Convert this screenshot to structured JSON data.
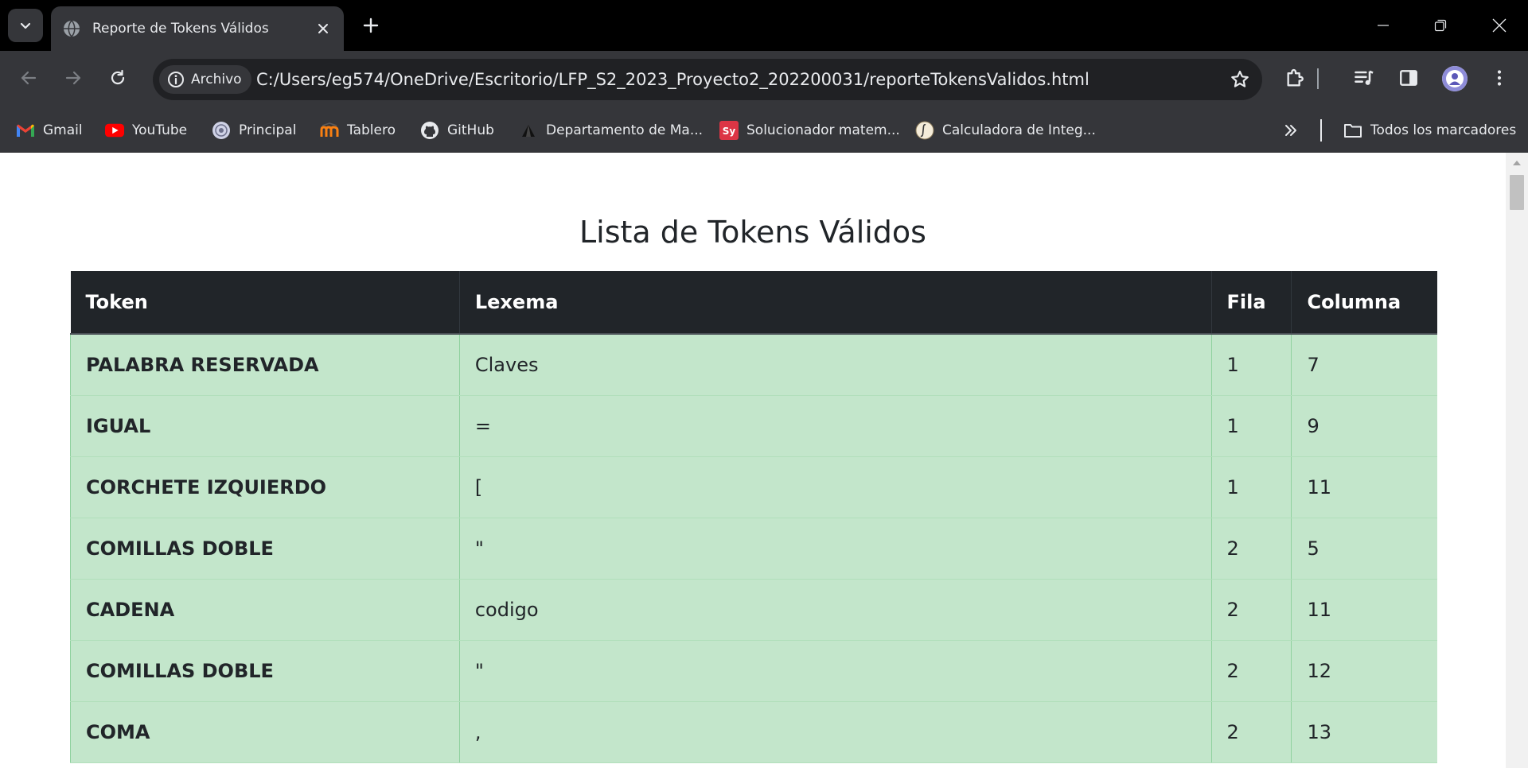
{
  "tab": {
    "title": "Reporte de Tokens Válidos"
  },
  "address_bar": {
    "site_chip": "Archivo",
    "url": "C:/Users/eg574/OneDrive/Escritorio/LFP_S2_2023_Proyecto2_202200031/reporteTokensValidos.html"
  },
  "bookmarks": {
    "items": [
      {
        "label": "Gmail",
        "icon": "gmail-icon"
      },
      {
        "label": "YouTube",
        "icon": "youtube-icon"
      },
      {
        "label": "Principal",
        "icon": "principal-icon"
      },
      {
        "label": "Tablero",
        "icon": "moodle-icon"
      },
      {
        "label": "GitHub",
        "icon": "github-icon"
      },
      {
        "label": "Departamento de Ma...",
        "icon": "triangle-icon"
      },
      {
        "label": "Solucionador matem...",
        "icon": "symbolab-icon"
      },
      {
        "label": "Calculadora de Integ...",
        "icon": "integral-icon"
      }
    ],
    "all_bookmarks": "Todos los marcadores"
  },
  "page": {
    "title": "Lista de Tokens Válidos",
    "table": {
      "headers": [
        "Token",
        "Lexema",
        "Fila",
        "Columna"
      ],
      "rows": [
        [
          "PALABRA RESERVADA",
          "Claves",
          "1",
          "7"
        ],
        [
          "IGUAL",
          "=",
          "1",
          "9"
        ],
        [
          "CORCHETE IZQUIERDO",
          "[",
          "1",
          "11"
        ],
        [
          "COMILLAS DOBLE",
          "\"",
          "2",
          "5"
        ],
        [
          "CADENA",
          "codigo",
          "2",
          "11"
        ],
        [
          "COMILLAS DOBLE",
          "\"",
          "2",
          "12"
        ],
        [
          "COMA",
          ",",
          "2",
          "13"
        ]
      ]
    }
  },
  "colors": {
    "header_bg": "#212529",
    "row_bg": "#c3e6cb",
    "chrome_dark": "#35363a"
  }
}
